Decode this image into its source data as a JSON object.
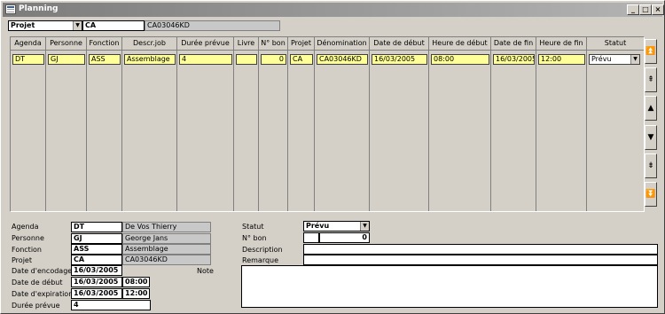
{
  "window": {
    "title": "Planning"
  },
  "titlebar_buttons": {
    "minimize": "_",
    "maximize": "□",
    "close": "×"
  },
  "filter": {
    "type": "Projet",
    "code": "CA",
    "name": "CA03046KD"
  },
  "grid": {
    "headers": [
      "Agenda",
      "Personne",
      "Fonction",
      "Descr.job",
      "Durée prévue",
      "Livre",
      "N° bon",
      "Projet",
      "Dénomination",
      "Date de début",
      "Heure de début",
      "Date de fin",
      "Heure de fin",
      "Statut"
    ],
    "rows": [
      {
        "agenda": "DT",
        "personne": "GJ",
        "fonction": "ASS",
        "descr_job": "Assemblage",
        "duree": "4",
        "livre": "",
        "n_bon": "0",
        "projet": "CA",
        "denomination": "CA03046KD",
        "date_debut": "16/03/2005",
        "heure_debut": "08:00",
        "date_fin": "16/03/2005",
        "heure_fin": "12:00",
        "statut": "Prévu"
      }
    ]
  },
  "scroll_buttons": [
    "⏫",
    "⇞",
    "▲",
    "▼",
    "⇟",
    "⏬"
  ],
  "detail": {
    "labels": {
      "agenda": "Agenda",
      "personne": "Personne",
      "fonction": "Fonction",
      "projet": "Projet",
      "date_encodage": "Date d'encodage",
      "date_debut": "Date de début",
      "date_expiration": "Date d'expiration",
      "duree_prevue": "Durée prévue",
      "note": "Note",
      "statut": "Statut",
      "n_bon": "N° bon",
      "description": "Description",
      "remarque": "Remarque"
    },
    "agenda_code": "DT",
    "agenda_name": "De Vos Thierry",
    "personne_code": "GJ",
    "personne_name": "George Jans",
    "fonction_code": "ASS",
    "fonction_name": "Assemblage",
    "projet_code": "CA",
    "projet_name": "CA03046KD",
    "date_encodage": "16/03/2005",
    "date_debut": "16/03/2005",
    "heure_debut": "08:00",
    "date_expiration": "16/03/2005",
    "heure_expiration": "12:00",
    "duree_prevue": "4",
    "statut": "Prévu",
    "n_bon": "0",
    "description": "",
    "remarque": ""
  }
}
